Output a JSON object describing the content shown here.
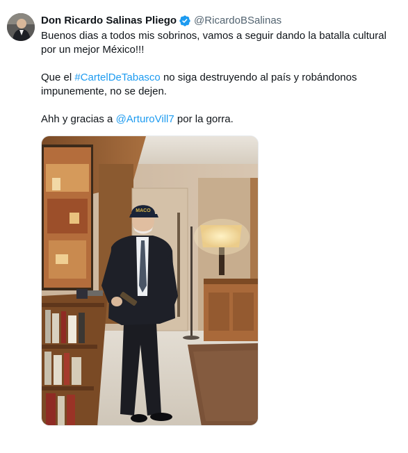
{
  "author": {
    "display_name": "Don Ricardo Salinas Pliego",
    "handle": "@RicardoBSalinas",
    "avatar_icon": "profile-avatar",
    "verified_icon": "verified-badge-icon",
    "verified_color": "#1d9bf0"
  },
  "tweet": {
    "line1": "Buenos dias a todos mis sobrinos, vamos a seguir dando la batalla cultural por un mejor México!!!",
    "p2_before": "Que el ",
    "p2_hashtag": "#CartelDeTabasco",
    "p2_after": " no siga destruyendo al país y robándonos impunemente, no se dejen.",
    "p3_before": "Ahh y gracias a ",
    "p3_mention": "@ArturoVill7",
    "p3_after": " por la gorra."
  },
  "photo": {
    "cap_text": "MACO"
  },
  "colors": {
    "text": "#0f1419",
    "secondary": "#536471",
    "link": "#1d9bf0"
  }
}
